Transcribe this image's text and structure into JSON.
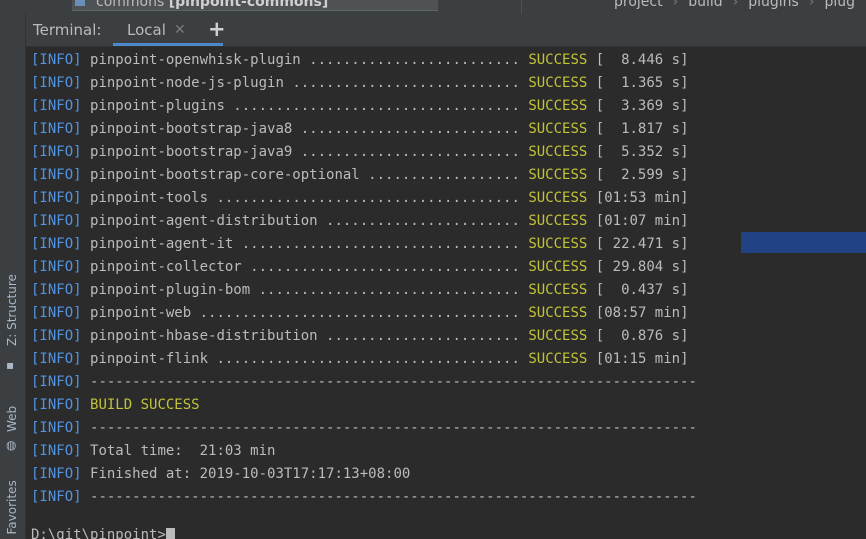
{
  "editor_tab": {
    "name": "commons",
    "module": "[pinpoint-commons]"
  },
  "breadcrumbs": [
    "project",
    "build",
    "plugins",
    "plug"
  ],
  "tool_window": {
    "title": "Terminal:",
    "tabs": [
      {
        "label": "Local"
      }
    ],
    "add_label": "+"
  },
  "sidebar": {
    "items": [
      {
        "label": "Z: Structure",
        "icon": "structure-icon"
      },
      {
        "label": "Web",
        "icon": "globe-icon"
      },
      {
        "label": "2: Favorites",
        "icon": "star-icon"
      }
    ]
  },
  "terminal": {
    "modules": [
      {
        "tag": "[INFO]",
        "name": "pinpoint-openwhisk-plugin",
        "dots": " .........................",
        "status": "SUCCESS",
        "time": "[  8.446 s]"
      },
      {
        "tag": "[INFO]",
        "name": "pinpoint-node-js-plugin",
        "dots": " ...........................",
        "status": "SUCCESS",
        "time": "[  1.365 s]"
      },
      {
        "tag": "[INFO]",
        "name": "pinpoint-plugins",
        "dots": " ..................................",
        "status": "SUCCESS",
        "time": "[  3.369 s]"
      },
      {
        "tag": "[INFO]",
        "name": "pinpoint-bootstrap-java8",
        "dots": " ..........................",
        "status": "SUCCESS",
        "time": "[  1.817 s]"
      },
      {
        "tag": "[INFO]",
        "name": "pinpoint-bootstrap-java9",
        "dots": " ..........................",
        "status": "SUCCESS",
        "time": "[  5.352 s]"
      },
      {
        "tag": "[INFO]",
        "name": "pinpoint-bootstrap-core-optional",
        "dots": " ..................",
        "status": "SUCCESS",
        "time": "[  2.599 s]"
      },
      {
        "tag": "[INFO]",
        "name": "pinpoint-tools",
        "dots": " ....................................",
        "status": "SUCCESS",
        "time": "[01:53 min]"
      },
      {
        "tag": "[INFO]",
        "name": "pinpoint-agent-distribution",
        "dots": " .......................",
        "status": "SUCCESS",
        "time": "[01:07 min]"
      },
      {
        "tag": "[INFO]",
        "name": "pinpoint-agent-it",
        "dots": " .................................",
        "status": "SUCCESS",
        "time": "[ 22.471 s]"
      },
      {
        "tag": "[INFO]",
        "name": "pinpoint-collector",
        "dots": " ................................",
        "status": "SUCCESS",
        "time": "[ 29.804 s]"
      },
      {
        "tag": "[INFO]",
        "name": "pinpoint-plugin-bom",
        "dots": " ...............................",
        "status": "SUCCESS",
        "time": "[  0.437 s]"
      },
      {
        "tag": "[INFO]",
        "name": "pinpoint-web",
        "dots": " ......................................",
        "status": "SUCCESS",
        "time": "[08:57 min]"
      },
      {
        "tag": "[INFO]",
        "name": "pinpoint-hbase-distribution",
        "dots": " .......................",
        "status": "SUCCESS",
        "time": "[  0.876 s]"
      },
      {
        "tag": "[INFO]",
        "name": "pinpoint-flink",
        "dots": " ....................................",
        "status": "SUCCESS",
        "time": "[01:15 min]"
      }
    ],
    "separator": "------------------------------------------------------------------------",
    "tag": "[INFO]",
    "build_result": "BUILD SUCCESS",
    "total_time": "Total time:  21:03 min",
    "finished_at": "Finished at: 2019-10-03T17:17:13+08:00",
    "prompt": "D:\\git\\pinpoint>"
  }
}
